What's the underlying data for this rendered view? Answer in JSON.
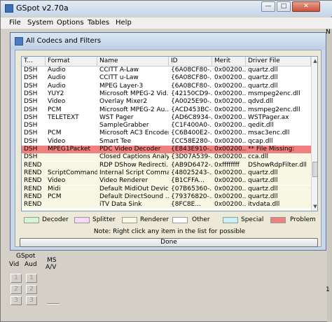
{
  "main_window": {
    "title": "GSpot v2.70a",
    "menu": [
      "File",
      "System",
      "Options",
      "Tables",
      "Help"
    ],
    "right_edge_top": "N",
    "right_edge_bottom": "1",
    "panel": {
      "gspot_label": "GSpot",
      "vid_label": "Vid",
      "aud_label": "Aud",
      "ms_label": "MS",
      "av_label": "A/V",
      "vid_buttons": [
        "1",
        "2",
        "3"
      ],
      "aud_buttons": [
        "1",
        "2",
        "3"
      ]
    }
  },
  "dialog": {
    "title": "All Codecs and Filters",
    "columns": [
      "T...",
      "Format",
      "Name",
      "ID",
      "Merit",
      "Driver File"
    ],
    "rows": [
      {
        "type": "DSH",
        "format": "Audio",
        "name": "CCITT A-Law",
        "id": "{6A08CF80-...",
        "merit": "0x00200...",
        "driver": "quartz.dll",
        "status": "normal"
      },
      {
        "type": "DSH",
        "format": "Audio",
        "name": "CCITT u-Law",
        "id": "{6A08CF80-...",
        "merit": "0x00200...",
        "driver": "quartz.dll",
        "status": "normal"
      },
      {
        "type": "DSH",
        "format": "Audio",
        "name": "MPEG Layer-3",
        "id": "{6A08CF80-...",
        "merit": "0x00200...",
        "driver": "quartz.dll",
        "status": "normal"
      },
      {
        "type": "DSH",
        "format": "YUY2",
        "name": "Microsoft MPEG-2 Vid...",
        "id": "{42150CD9-...",
        "merit": "0x00200...",
        "driver": "msmpeg2enc.dll",
        "status": "normal"
      },
      {
        "type": "DSH",
        "format": "Video",
        "name": "Overlay Mixer2",
        "id": "{A0025E90-...",
        "merit": "0x00200...",
        "driver": "qdvd.dll",
        "status": "normal"
      },
      {
        "type": "DSH",
        "format": "PCM",
        "name": "Microsoft MPEG-2 Au...",
        "id": "{ACD453BC-...",
        "merit": "0x00200...",
        "driver": "msmpeg2enc.dll",
        "status": "normal"
      },
      {
        "type": "DSH",
        "format": "TELETEXT",
        "name": "WST Pager",
        "id": "{AD6C8934-...",
        "merit": "0x00200...",
        "driver": "WSTPager.ax",
        "status": "normal"
      },
      {
        "type": "DSH",
        "format": "",
        "name": "SampleGrabber",
        "id": "{C1F400A0-...",
        "merit": "0x00200...",
        "driver": "qedit.dll",
        "status": "normal"
      },
      {
        "type": "DSH",
        "format": "PCM",
        "name": "Microsoft AC3 Encoder",
        "id": "{C6B400E2-...",
        "merit": "0x00200...",
        "driver": "msac3enc.dll",
        "status": "normal"
      },
      {
        "type": "DSH",
        "format": "Video",
        "name": "Smart Tee",
        "id": "{CC58E280-...",
        "merit": "0x00200...",
        "driver": "qcap.dll",
        "status": "normal"
      },
      {
        "type": "DSH",
        "format": "MPEG1Packet",
        "name": "PDC Video Decoder",
        "id": "{E843E910-...",
        "merit": "0x00200...",
        "driver": "** File Missing:",
        "status": "problem"
      },
      {
        "type": "DSH",
        "format": "",
        "name": "Closed Captions Analy...",
        "id": "{3D07A539-...",
        "merit": "0x00200...",
        "driver": "cca.dll",
        "status": "renderer"
      },
      {
        "type": "REND",
        "format": "",
        "name": "RDP DShow Redirecti...",
        "id": "{AB9D6472-...",
        "merit": "0xffffffff",
        "driver": "DShowRdpFilter.dll",
        "status": "renderer"
      },
      {
        "type": "REND",
        "format": "ScriptCommand",
        "name": "Internal Script Comma...",
        "id": "{48025243-...",
        "merit": "0x00200...",
        "driver": "quartz.dll",
        "status": "renderer"
      },
      {
        "type": "REND",
        "format": "Video",
        "name": "Video Renderer",
        "id": "{B1CFFA...",
        "merit": "0x00200...",
        "driver": "quartz.dll",
        "status": "renderer"
      },
      {
        "type": "REND",
        "format": "Midi",
        "name": "Default MidiOut Device",
        "id": "{07B65360-...",
        "merit": "0x00200...",
        "driver": "quartz.dll",
        "status": "renderer"
      },
      {
        "type": "REND",
        "format": "PCM",
        "name": "Default DirectSound ...",
        "id": "{79376820-...",
        "merit": "0x00200...",
        "driver": "quartz.dll",
        "status": "renderer"
      },
      {
        "type": "REND",
        "format": "",
        "name": "iTV Data Sink",
        "id": "{8FC8E...",
        "merit": "0x00200...",
        "driver": "itvdata.dll",
        "status": "renderer"
      }
    ],
    "legend": [
      {
        "label": "Decoder",
        "color": "#d8f5d2"
      },
      {
        "label": "Splitter",
        "color": "#f7d9f3"
      },
      {
        "label": "Renderer",
        "color": "#f8f7e3"
      },
      {
        "label": "Other",
        "color": "#ffffff"
      },
      {
        "label": "Special",
        "color": "#c8f1f7"
      },
      {
        "label": "Problem",
        "color": "#f07f7f"
      }
    ],
    "note": "Note: Right click any item in the list for possible",
    "done_label": "Done"
  }
}
